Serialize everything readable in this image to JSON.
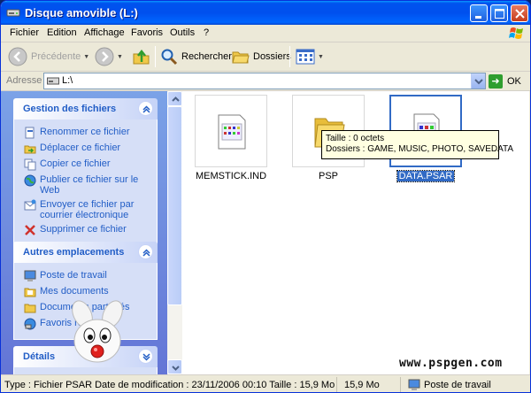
{
  "window": {
    "title": "Disque amovible (L:)"
  },
  "menu": [
    "Fichier",
    "Edition",
    "Affichage",
    "Favoris",
    "Outils",
    "?"
  ],
  "toolbar": {
    "back": "Précédente",
    "search": "Rechercher",
    "folders": "Dossiers"
  },
  "address": {
    "label": "Adresse",
    "value": "L:\\",
    "go": "OK"
  },
  "taskpane": {
    "file_tasks": {
      "title": "Gestion des fichiers",
      "items": [
        {
          "label": "Renommer ce fichier",
          "icon": "rename-icon"
        },
        {
          "label": "Déplacer ce fichier",
          "icon": "move-icon"
        },
        {
          "label": "Copier ce fichier",
          "icon": "copy-icon"
        },
        {
          "label": "Publier ce fichier sur le Web",
          "icon": "publish-web-icon"
        },
        {
          "label": "Envoyer ce fichier par courrier électronique",
          "icon": "email-icon"
        },
        {
          "label": "Supprimer ce fichier",
          "icon": "delete-icon"
        }
      ]
    },
    "other_places": {
      "title": "Autres emplacements",
      "items": [
        {
          "label": "Poste de travail",
          "icon": "my-computer-icon"
        },
        {
          "label": "Mes documents",
          "icon": "my-documents-icon"
        },
        {
          "label": "Documents partagés",
          "icon": "shared-documents-icon"
        },
        {
          "label": "Favoris réseau",
          "icon": "network-places-icon"
        }
      ]
    },
    "details": {
      "title": "Détails"
    }
  },
  "files": [
    {
      "name": "MEMSTICK.IND",
      "type": "file",
      "selected": false
    },
    {
      "name": "PSP",
      "type": "folder",
      "selected": false
    },
    {
      "name": "DATA.PSAR",
      "type": "file",
      "selected": true
    }
  ],
  "tooltip": {
    "line1": "Taille : 0 octets",
    "line2": "Dossiers : GAME, MUSIC, PHOTO, SAVEDATA"
  },
  "status": {
    "info": "Type : Fichier PSAR Date de modification : 23/11/2006 00:10 Taille  : 15,9 Mo",
    "size": "15,9 Mo",
    "zone": "Poste de travail"
  },
  "watermark": "www.pspgen.com",
  "colors": {
    "titlebar": "#0053ee",
    "taskpane": "#6f8fe0",
    "link": "#215dc6",
    "selection": "#316ac5",
    "tooltip": "#ffffe1"
  }
}
